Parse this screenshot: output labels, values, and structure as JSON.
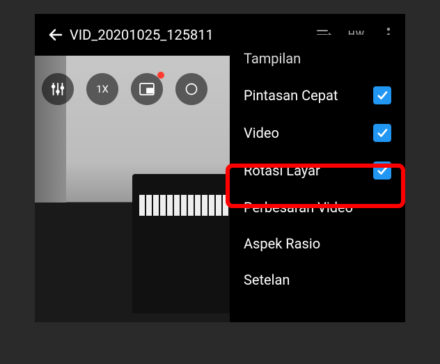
{
  "top": {
    "title": "VID_20201025_125811",
    "hw_label": "HW"
  },
  "float": {
    "speed": "1X"
  },
  "menu": {
    "header": "Tampilan",
    "items": [
      {
        "label": "Pintasan Cepat",
        "checked": true
      },
      {
        "label": "Video",
        "checked": true
      },
      {
        "label": "Rotasi Layar",
        "checked": true
      },
      {
        "label": "Perbesaran Video",
        "checked": false
      },
      {
        "label": "Aspek Rasio",
        "checked": false
      },
      {
        "label": "Setelan",
        "checked": false
      }
    ]
  }
}
